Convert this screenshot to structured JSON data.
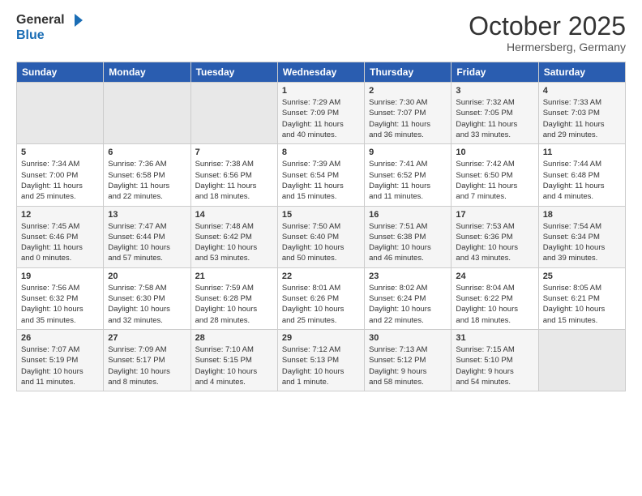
{
  "logo": {
    "line1": "General",
    "line2": "Blue"
  },
  "header": {
    "month": "October 2025",
    "location": "Hermersberg, Germany"
  },
  "weekdays": [
    "Sunday",
    "Monday",
    "Tuesday",
    "Wednesday",
    "Thursday",
    "Friday",
    "Saturday"
  ],
  "weeks": [
    [
      {
        "day": "",
        "info": ""
      },
      {
        "day": "",
        "info": ""
      },
      {
        "day": "",
        "info": ""
      },
      {
        "day": "1",
        "info": "Sunrise: 7:29 AM\nSunset: 7:09 PM\nDaylight: 11 hours\nand 40 minutes."
      },
      {
        "day": "2",
        "info": "Sunrise: 7:30 AM\nSunset: 7:07 PM\nDaylight: 11 hours\nand 36 minutes."
      },
      {
        "day": "3",
        "info": "Sunrise: 7:32 AM\nSunset: 7:05 PM\nDaylight: 11 hours\nand 33 minutes."
      },
      {
        "day": "4",
        "info": "Sunrise: 7:33 AM\nSunset: 7:03 PM\nDaylight: 11 hours\nand 29 minutes."
      }
    ],
    [
      {
        "day": "5",
        "info": "Sunrise: 7:34 AM\nSunset: 7:00 PM\nDaylight: 11 hours\nand 25 minutes."
      },
      {
        "day": "6",
        "info": "Sunrise: 7:36 AM\nSunset: 6:58 PM\nDaylight: 11 hours\nand 22 minutes."
      },
      {
        "day": "7",
        "info": "Sunrise: 7:38 AM\nSunset: 6:56 PM\nDaylight: 11 hours\nand 18 minutes."
      },
      {
        "day": "8",
        "info": "Sunrise: 7:39 AM\nSunset: 6:54 PM\nDaylight: 11 hours\nand 15 minutes."
      },
      {
        "day": "9",
        "info": "Sunrise: 7:41 AM\nSunset: 6:52 PM\nDaylight: 11 hours\nand 11 minutes."
      },
      {
        "day": "10",
        "info": "Sunrise: 7:42 AM\nSunset: 6:50 PM\nDaylight: 11 hours\nand 7 minutes."
      },
      {
        "day": "11",
        "info": "Sunrise: 7:44 AM\nSunset: 6:48 PM\nDaylight: 11 hours\nand 4 minutes."
      }
    ],
    [
      {
        "day": "12",
        "info": "Sunrise: 7:45 AM\nSunset: 6:46 PM\nDaylight: 11 hours\nand 0 minutes."
      },
      {
        "day": "13",
        "info": "Sunrise: 7:47 AM\nSunset: 6:44 PM\nDaylight: 10 hours\nand 57 minutes."
      },
      {
        "day": "14",
        "info": "Sunrise: 7:48 AM\nSunset: 6:42 PM\nDaylight: 10 hours\nand 53 minutes."
      },
      {
        "day": "15",
        "info": "Sunrise: 7:50 AM\nSunset: 6:40 PM\nDaylight: 10 hours\nand 50 minutes."
      },
      {
        "day": "16",
        "info": "Sunrise: 7:51 AM\nSunset: 6:38 PM\nDaylight: 10 hours\nand 46 minutes."
      },
      {
        "day": "17",
        "info": "Sunrise: 7:53 AM\nSunset: 6:36 PM\nDaylight: 10 hours\nand 43 minutes."
      },
      {
        "day": "18",
        "info": "Sunrise: 7:54 AM\nSunset: 6:34 PM\nDaylight: 10 hours\nand 39 minutes."
      }
    ],
    [
      {
        "day": "19",
        "info": "Sunrise: 7:56 AM\nSunset: 6:32 PM\nDaylight: 10 hours\nand 35 minutes."
      },
      {
        "day": "20",
        "info": "Sunrise: 7:58 AM\nSunset: 6:30 PM\nDaylight: 10 hours\nand 32 minutes."
      },
      {
        "day": "21",
        "info": "Sunrise: 7:59 AM\nSunset: 6:28 PM\nDaylight: 10 hours\nand 28 minutes."
      },
      {
        "day": "22",
        "info": "Sunrise: 8:01 AM\nSunset: 6:26 PM\nDaylight: 10 hours\nand 25 minutes."
      },
      {
        "day": "23",
        "info": "Sunrise: 8:02 AM\nSunset: 6:24 PM\nDaylight: 10 hours\nand 22 minutes."
      },
      {
        "day": "24",
        "info": "Sunrise: 8:04 AM\nSunset: 6:22 PM\nDaylight: 10 hours\nand 18 minutes."
      },
      {
        "day": "25",
        "info": "Sunrise: 8:05 AM\nSunset: 6:21 PM\nDaylight: 10 hours\nand 15 minutes."
      }
    ],
    [
      {
        "day": "26",
        "info": "Sunrise: 7:07 AM\nSunset: 5:19 PM\nDaylight: 10 hours\nand 11 minutes."
      },
      {
        "day": "27",
        "info": "Sunrise: 7:09 AM\nSunset: 5:17 PM\nDaylight: 10 hours\nand 8 minutes."
      },
      {
        "day": "28",
        "info": "Sunrise: 7:10 AM\nSunset: 5:15 PM\nDaylight: 10 hours\nand 4 minutes."
      },
      {
        "day": "29",
        "info": "Sunrise: 7:12 AM\nSunset: 5:13 PM\nDaylight: 10 hours\nand 1 minute."
      },
      {
        "day": "30",
        "info": "Sunrise: 7:13 AM\nSunset: 5:12 PM\nDaylight: 9 hours\nand 58 minutes."
      },
      {
        "day": "31",
        "info": "Sunrise: 7:15 AM\nSunset: 5:10 PM\nDaylight: 9 hours\nand 54 minutes."
      },
      {
        "day": "",
        "info": ""
      }
    ]
  ]
}
